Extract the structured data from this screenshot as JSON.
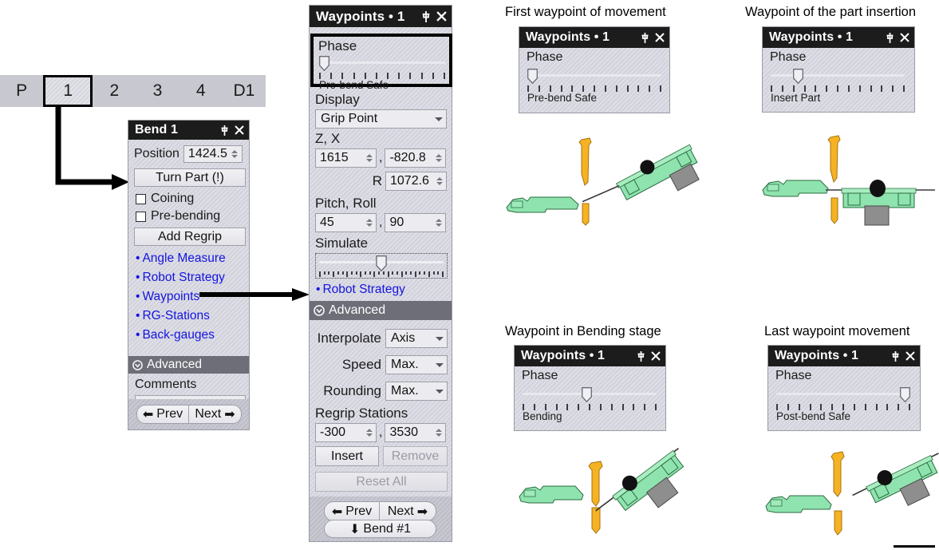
{
  "tabstrip": {
    "tabs": [
      {
        "label": "P",
        "selected": false
      },
      {
        "label": "1",
        "selected": true
      },
      {
        "label": "2",
        "selected": false
      },
      {
        "label": "3",
        "selected": false
      },
      {
        "label": "4",
        "selected": false
      },
      {
        "label": "D1",
        "selected": false
      }
    ]
  },
  "bend_panel": {
    "title": "Bend 1",
    "position_label": "Position",
    "position_value": "1424.5",
    "turn_part_label": "Turn Part (!)",
    "coining_label": "Coining",
    "coining_checked": false,
    "prebending_label": "Pre-bending",
    "prebending_checked": false,
    "add_regrip_label": "Add Regrip",
    "links": [
      "Angle Measure",
      "Robot Strategy",
      "Waypoints",
      "RG-Stations",
      "Back-gauges"
    ],
    "advanced_label": "Advanced",
    "comments_label": "Comments",
    "comments_value": "",
    "prev_label": "Prev",
    "next_label": "Next"
  },
  "waypoints_panel": {
    "title": "Waypoints • 1",
    "phase_label": "Phase",
    "phase_value": "Pre-bend Safe",
    "phase_pos_pct": 0,
    "phase_ticks": 12,
    "display_label": "Display",
    "display_value": "Grip Point",
    "zx_label": "Z, X",
    "z_value": "1615",
    "x_value": "-820.8",
    "r_label": "R",
    "r_value": "1072.6",
    "pitchroll_label": "Pitch, Roll",
    "pitch_value": "45",
    "roll_value": "90",
    "simulate_label": "Simulate",
    "simulate_pos_pct": 50,
    "robot_strategy_link": "Robot Strategy",
    "advanced_label": "Advanced",
    "interpolate_label": "Interpolate",
    "interpolate_value": "Axis",
    "speed_label": "Speed",
    "speed_value": "Max.",
    "rounding_label": "Rounding",
    "rounding_value": "Max.",
    "regrip_stations_label": "Regrip Stations",
    "regrip_a_value": "-300",
    "regrip_b_value": "3530",
    "insert_label": "Insert",
    "remove_label": "Remove",
    "reset_all_label": "Reset All",
    "prev_label": "Prev",
    "next_label": "Next",
    "bend_nav_label": "Bend #1"
  },
  "examples": [
    {
      "caption": "First waypoint of movement",
      "title": "Waypoints • 1",
      "phase_label": "Phase",
      "phase_value": "Pre-bend Safe",
      "phase_pos_pct": 0,
      "phase_ticks": 13
    },
    {
      "caption": "Waypoint of the part insertion",
      "title": "Waypoints • 1",
      "phase_label": "Phase",
      "phase_value": "Insert Part",
      "phase_pos_pct": 18,
      "phase_ticks": 13
    },
    {
      "caption": "Waypoint in Bending stage",
      "title": "Waypoints • 1",
      "phase_label": "Phase",
      "phase_value": "Bending",
      "phase_pos_pct": 48,
      "phase_ticks": 13
    },
    {
      "caption": "Last waypoint movement",
      "title": "Waypoints • 1",
      "phase_label": "Phase",
      "phase_value": "Post-bend Safe",
      "phase_pos_pct": 100,
      "phase_ticks": 13
    }
  ],
  "colors": {
    "link": "#1414e0",
    "panel_bg": "#d9d9e1",
    "titlebar_bg": "#1c1c1c",
    "advanced_band": "#6e6e78",
    "part_green": "#8fe3ae",
    "tool_orange": "#f5b324",
    "gripper_gray": "#8e8e8e",
    "tab_strip": "#c8c8d0"
  }
}
